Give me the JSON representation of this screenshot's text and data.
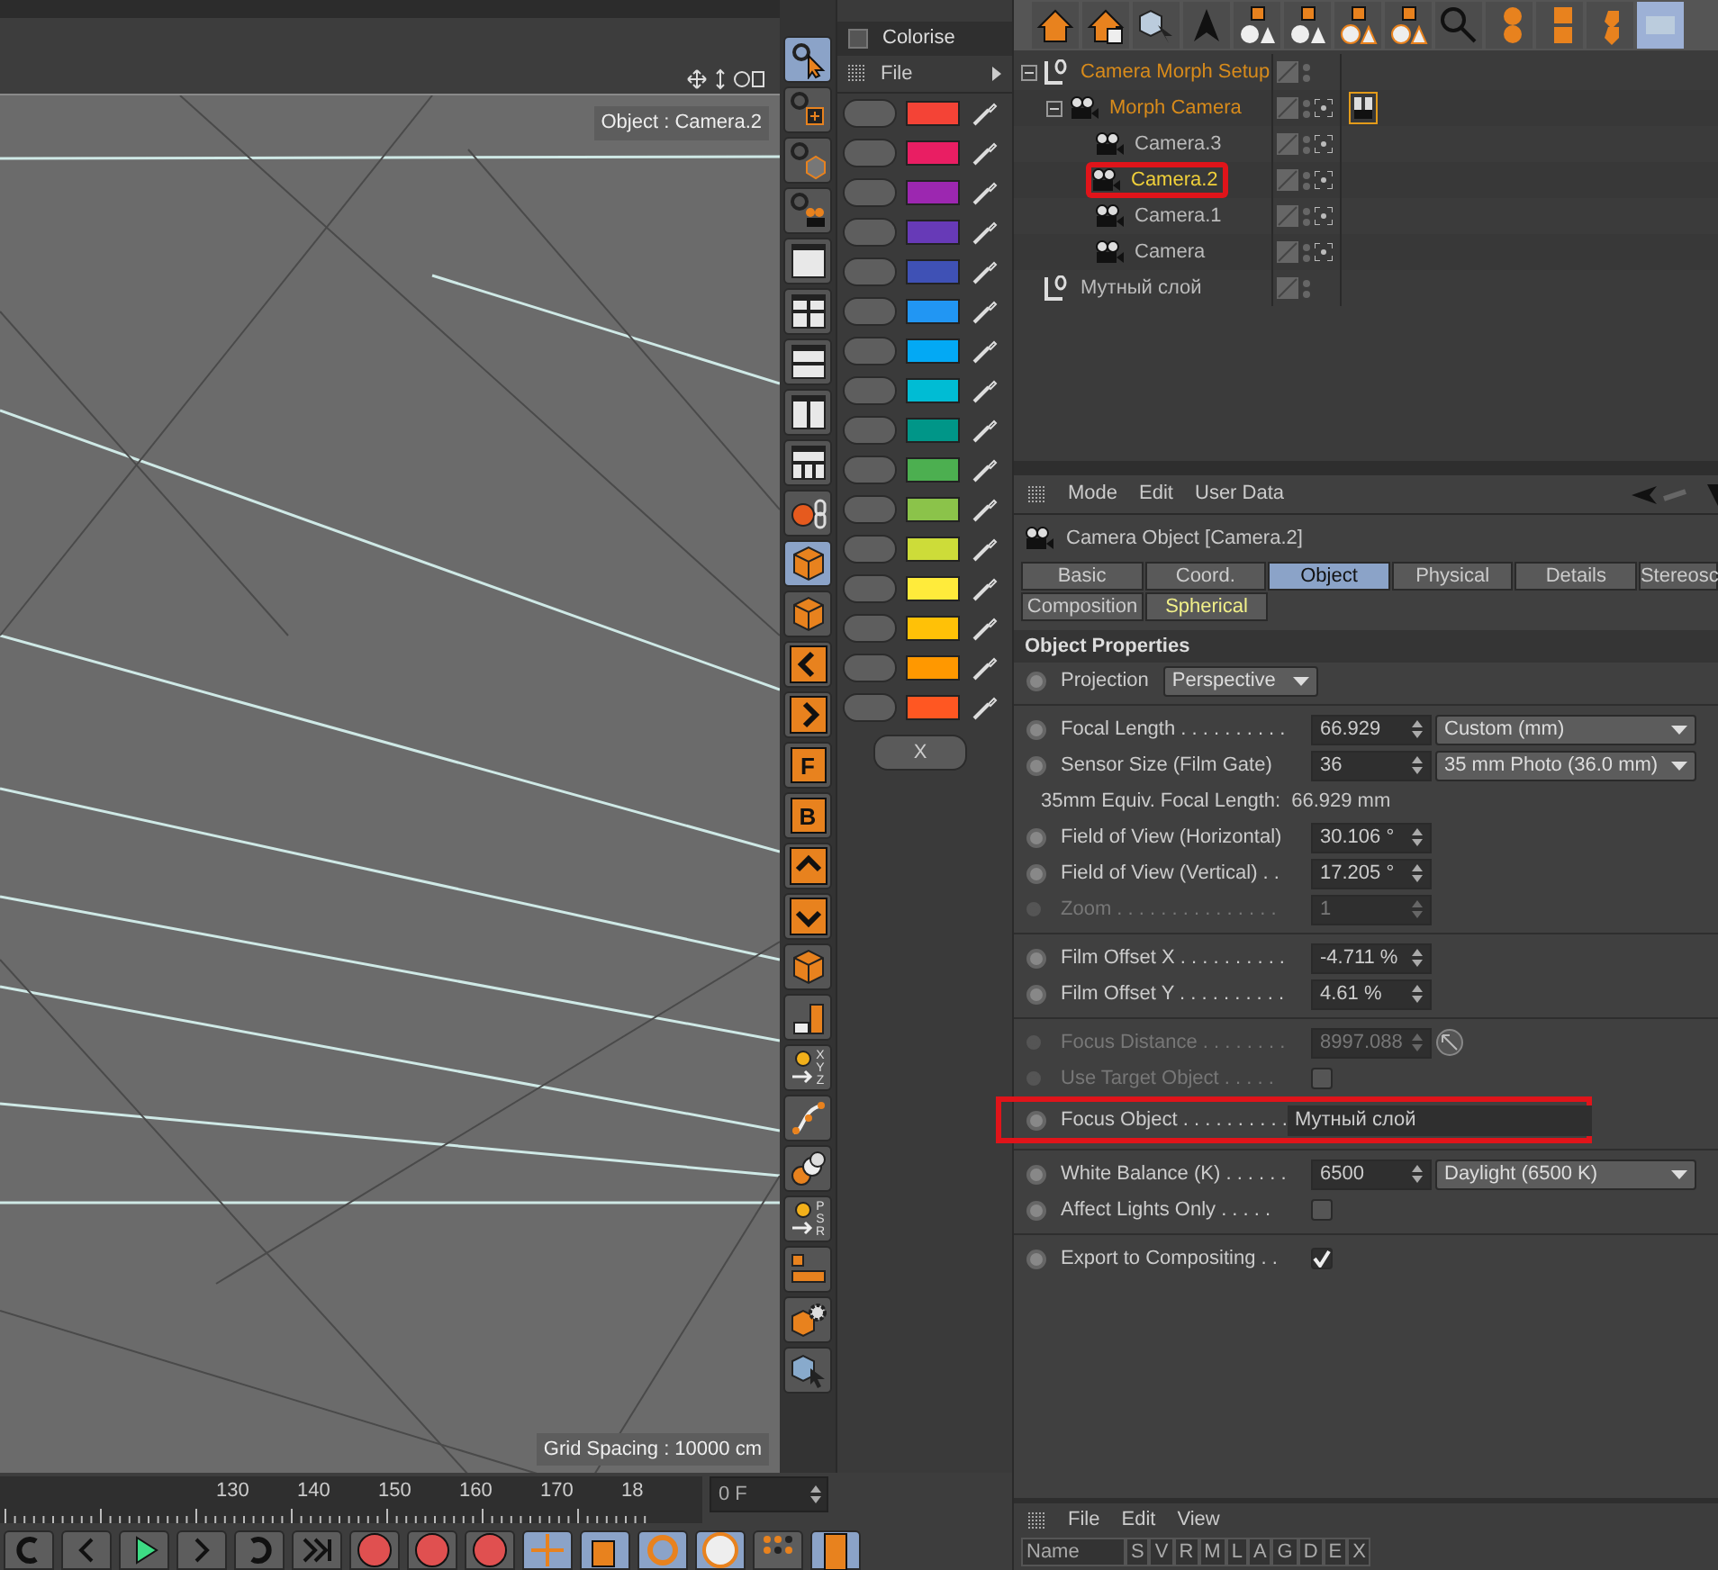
{
  "viewport": {
    "object_label": "Object : Camera.2",
    "grid_spacing": "Grid Spacing : 10000 cm"
  },
  "tools": [
    {
      "kind": "cursor",
      "selected": true
    },
    {
      "kind": "frame-cycle",
      "selected": false
    },
    {
      "kind": "cube-cycle",
      "selected": false
    },
    {
      "kind": "camera-cycle",
      "selected": false
    },
    {
      "kind": "layout-single",
      "selected": false
    },
    {
      "kind": "layout-quad",
      "selected": false
    },
    {
      "kind": "layout-rows",
      "selected": false
    },
    {
      "kind": "layout-columns",
      "selected": false
    },
    {
      "kind": "layout-grid",
      "selected": false
    },
    {
      "kind": "sphere-link",
      "selected": false
    },
    {
      "kind": "cube",
      "selected": true
    },
    {
      "kind": "cube",
      "selected": false
    },
    {
      "kind": "chevron-left",
      "selected": false
    },
    {
      "kind": "chevron-right",
      "selected": false
    },
    {
      "kind": "letter",
      "label": "F",
      "selected": false
    },
    {
      "kind": "letter",
      "label": "B",
      "selected": false
    },
    {
      "kind": "chevron-up",
      "selected": false
    },
    {
      "kind": "chevron-down",
      "selected": false
    },
    {
      "kind": "cube",
      "selected": false
    },
    {
      "kind": "bars",
      "selected": false
    },
    {
      "kind": "axis-letters",
      "label": "XYZ",
      "selected": false
    },
    {
      "kind": "curve",
      "selected": false
    },
    {
      "kind": "spheres",
      "selected": false
    },
    {
      "kind": "axis-letters",
      "label": "PSR",
      "selected": false
    },
    {
      "kind": "align",
      "selected": false
    },
    {
      "kind": "cube-gear",
      "selected": false
    },
    {
      "kind": "cube-cursor",
      "selected": false
    }
  ],
  "colorise": {
    "title": "Colorise",
    "checked": false,
    "menu": "File",
    "button": "X",
    "swatches": [
      {
        "color": "#f44336"
      },
      {
        "color": "#e91e63"
      },
      {
        "color": "#9c27b0"
      },
      {
        "color": "#673ab7"
      },
      {
        "color": "#3f51b5"
      },
      {
        "color": "#2196f3"
      },
      {
        "color": "#03a9f4"
      },
      {
        "color": "#00bcd4"
      },
      {
        "color": "#009688"
      },
      {
        "color": "#4caf50"
      },
      {
        "color": "#8bc34a"
      },
      {
        "color": "#cddc39"
      },
      {
        "color": "#ffeb3b"
      },
      {
        "color": "#ffc107"
      },
      {
        "color": "#ff9800"
      },
      {
        "color": "#ff5722"
      }
    ]
  },
  "timeline": {
    "labels": [
      "130",
      "140",
      "150",
      "160",
      "170",
      "18"
    ],
    "frame": "0 F"
  },
  "objects": [
    {
      "name": "Camera Morph Setup",
      "kind": "null",
      "active": true,
      "selected": false,
      "expanded": true,
      "children": [
        {
          "name": "Morph Camera",
          "kind": "camera",
          "active": true,
          "selected": false,
          "expanded": true,
          "tag": {
            "kind": "morph",
            "selected": true
          },
          "children": [
            {
              "name": "Camera.3",
              "kind": "camera",
              "selected": false
            },
            {
              "name": "Camera.2",
              "kind": "camera",
              "selected": true,
              "outlined": true
            },
            {
              "name": "Camera.1",
              "kind": "camera",
              "selected": false
            },
            {
              "name": "Camera",
              "kind": "camera",
              "selected": false
            }
          ]
        }
      ]
    },
    {
      "name": "Мутный слой",
      "kind": "null",
      "selected": false
    }
  ],
  "attributes": {
    "menu": [
      "Mode",
      "Edit",
      "User Data"
    ],
    "title": "Camera Object [Camera.2]",
    "tabs": [
      [
        {
          "label": "Basic",
          "selected": false,
          "highlighted": false
        },
        {
          "label": "Coord.",
          "selected": false,
          "highlighted": false
        },
        {
          "label": "Object",
          "selected": true,
          "highlighted": false
        },
        {
          "label": "Physical",
          "selected": false,
          "highlighted": false
        },
        {
          "label": "Details",
          "selected": false,
          "highlighted": false
        },
        {
          "label": "Stereosc",
          "selected": false,
          "highlighted": false
        }
      ],
      [
        {
          "label": "Composition",
          "selected": false,
          "highlighted": false
        },
        {
          "label": "Spherical",
          "selected": false,
          "highlighted": true
        }
      ]
    ],
    "section": "Object Properties",
    "params": [
      {
        "kind": "dropdown",
        "label": "Projection",
        "choice": "Perspective",
        "disabled": false
      },
      {
        "kind": "separator"
      },
      {
        "kind": "number_dropdown",
        "label": "Focal Length . . . . . . . . . .",
        "value": "66.929",
        "choice": "Custom (mm)",
        "disabled": false
      },
      {
        "kind": "number_dropdown",
        "label": "Sensor Size (Film Gate)",
        "value": "36",
        "choice": "35 mm Photo (36.0 mm)",
        "disabled": false
      },
      {
        "kind": "info",
        "label": "35mm Equiv. Focal Length:",
        "value": "66.929 mm"
      },
      {
        "kind": "number",
        "label": "Field of View (Horizontal)",
        "value": "30.106 °",
        "disabled": false
      },
      {
        "kind": "number",
        "label": "Field of View (Vertical) . .",
        "value": "17.205 °",
        "disabled": false
      },
      {
        "kind": "number",
        "label": "Zoom . . . . . . . . . . . . . . .",
        "value": "1",
        "disabled": true
      },
      {
        "kind": "separator"
      },
      {
        "kind": "number",
        "label": "Film Offset X . . . . . . . . . .",
        "value": "-4.711 %",
        "disabled": false
      },
      {
        "kind": "number",
        "label": "Film Offset Y . . . . . . . . . .",
        "value": "4.61 %",
        "disabled": false
      },
      {
        "kind": "separator"
      },
      {
        "kind": "number_pick",
        "label": "Focus Distance . . . . . . . .",
        "value": "8997.088",
        "disabled": true
      },
      {
        "kind": "checkbox",
        "label": "Use Target Object . . . . .",
        "checked": false,
        "disabled": true
      },
      {
        "kind": "link",
        "label": "Focus Object . . . . . . . . . .",
        "value": "Мутный слой",
        "disabled": false,
        "outlined": true
      },
      {
        "kind": "separator"
      },
      {
        "kind": "number_dropdown",
        "label": "White Balance (K) . . . . . .",
        "value": "6500",
        "choice": "Daylight (6500 K)",
        "disabled": false
      },
      {
        "kind": "checkbox",
        "label": "Affect Lights Only . . . . .",
        "checked": false,
        "disabled": false
      },
      {
        "kind": "separator"
      },
      {
        "kind": "checkbox",
        "label": "Export to Compositing . .",
        "checked": true,
        "disabled": false
      }
    ]
  },
  "layers": {
    "menu": [
      "File",
      "Edit",
      "View"
    ],
    "columns": [
      "Name",
      "S",
      "V",
      "R",
      "M",
      "L",
      "A",
      "G",
      "D",
      "E",
      "X"
    ]
  }
}
